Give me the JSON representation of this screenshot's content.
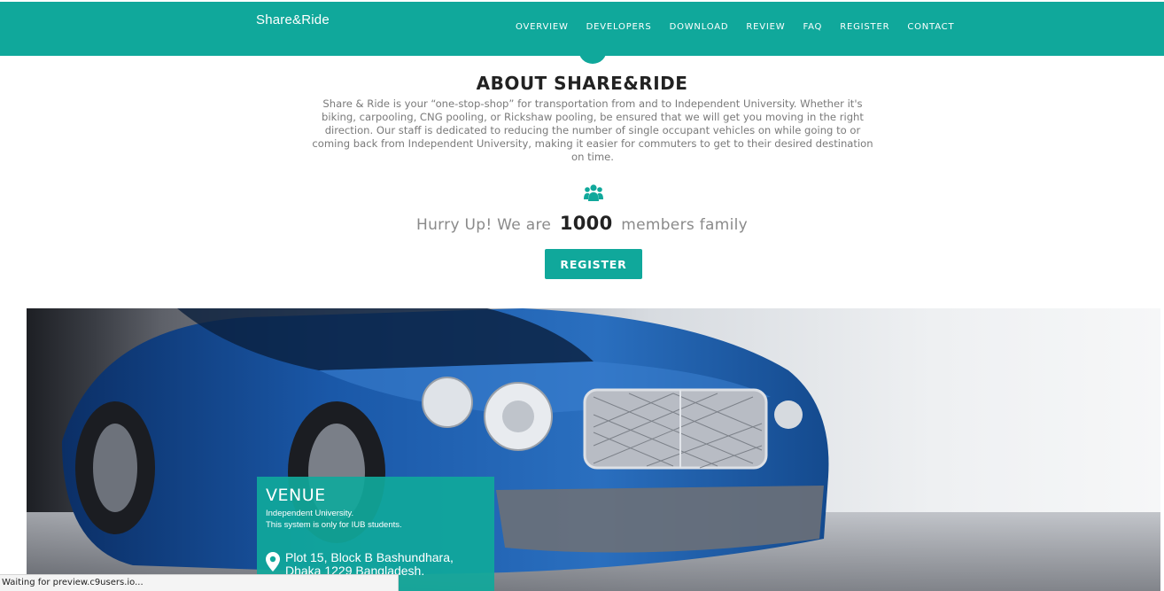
{
  "navbar": {
    "brand": "Share&Ride",
    "items": [
      {
        "label": "OVERVIEW"
      },
      {
        "label": "DEVELOPERS"
      },
      {
        "label": "DOWNLOAD"
      },
      {
        "label": "REVIEW"
      },
      {
        "label": "FAQ"
      },
      {
        "label": "REGISTER"
      },
      {
        "label": "CONTACT"
      }
    ],
    "color": "#10a89b"
  },
  "about": {
    "title": "ABOUT SHARE&RIDE",
    "text": "Share & Ride is your “one-stop-shop” for transportation from and to Independent University. Whether it's biking, carpooling, CNG pooling, or Rickshaw pooling, be ensured that we will get you moving in the right direction. Our staff is dedicated to reducing the number of single occupant vehicles on while going to or coming back from Independent University, making it easier for commuters to get to their desired destination on time."
  },
  "members": {
    "icon": "users-icon",
    "prefix": "Hurry Up! We are",
    "count": "1000",
    "suffix": "members family"
  },
  "register_button": "REGISTER",
  "venue": {
    "title": "VENUE",
    "line1": "Independent University.",
    "line2": "This system is only for IUB students.",
    "icon": "map-pin-icon",
    "address_line1": "Plot 15, Block B Bashundhara,",
    "address_line2": "Dhaka 1229 Bangladesh."
  },
  "status_bar": {
    "text": "Waiting for preview.c9users.io..."
  }
}
